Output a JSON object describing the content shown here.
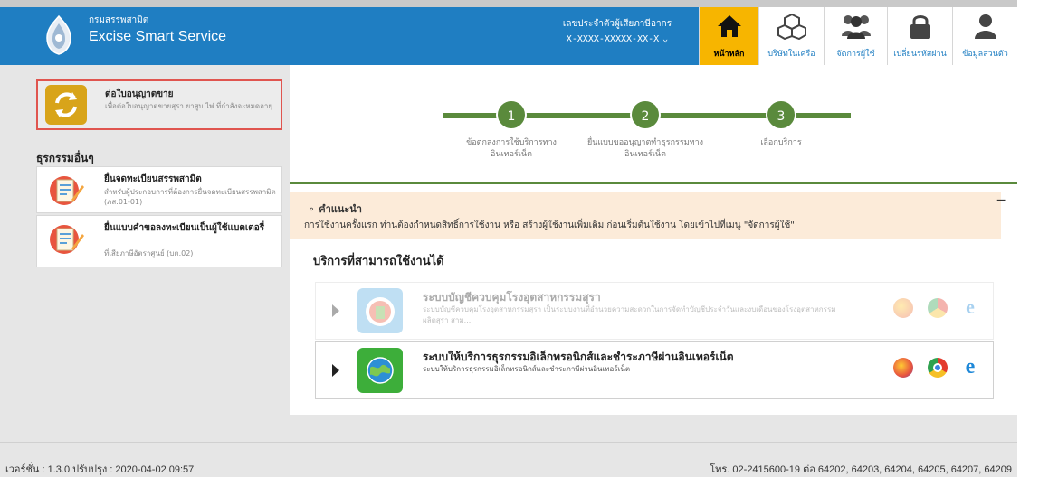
{
  "header": {
    "department": "กรมสรรพสามิต",
    "app_title": "Excise Smart Service",
    "taxid_label": "เลขประจำตัวผู้เสียภาษีอากร",
    "taxid_value": "X-XXXX-XXXXX-XX-X",
    "taxid_chevron": "⌄",
    "brand_color": "#1f7ec2",
    "active_color": "#f7b500"
  },
  "nav": [
    {
      "label": "หน้าหลัก",
      "icon": "home-icon",
      "active": true
    },
    {
      "label": "บริษัทในเครือ",
      "icon": "boxes-icon",
      "active": false
    },
    {
      "label": "จัดการผู้ใช้",
      "icon": "users-icon",
      "active": false
    },
    {
      "label": "เปลี่ยนรหัสผ่าน",
      "icon": "lock-icon",
      "active": false
    },
    {
      "label": "ข้อมูลส่วนตัว",
      "icon": "user-icon",
      "active": false
    }
  ],
  "sidebar": {
    "renew": {
      "title": "ต่อใบอนุญาตขาย",
      "desc": "เพื่อต่อใบอนุญาตขายสุรา ยาสูบ ไพ่ ที่กำลังจะหมดอายุ"
    },
    "section_title": "ธุรกรรมอื่นๆ",
    "items": [
      {
        "title": "ยื่นจดทะเบียนสรรพสามิต",
        "desc": "สำหรับผู้ประกอบการที่ต้องการยื่นจดทะเบียนสรรพสามิต (ภส.01-01)"
      },
      {
        "title": "ยื่นแบบคำขอลงทะเบียนเป็นผู้ใช้แบตเตอรี่",
        "desc": "ที่เสียภาษีอัตราศูนย์ (บต.02)"
      }
    ]
  },
  "steps": [
    {
      "number": "1",
      "label": "ข้อตกลงการใช้บริการทางอินเทอร์เน็ต"
    },
    {
      "number": "2",
      "label": "ยื่นแบบขออนุญาตทำธุรกรรมทางอินเทอร์เน็ต"
    },
    {
      "number": "3",
      "label": "เลือกบริการ"
    }
  ],
  "tip": {
    "title": "คำแนะนำ",
    "text": "การใช้งานครั้งแรก ท่านต้องกำหนดสิทธิ์การใช้งาน หรือ สร้างผู้ใช้งานเพิ่มเติม ก่อนเริ่มต้นใช้งาน โดยเข้าไปที่เมนู \"จัดการผู้ใช้\"",
    "collapse": "−"
  },
  "services": {
    "title": "บริการที่สามารถใช้งานได้",
    "items": [
      {
        "title": "ระบบบัญชีควบคุมโรงอุตสาหกรรมสุรา",
        "desc": "ระบบบัญชีควบคุมโรงอุตสาหกรรมสุรา เป็นระบบงานที่อำนวยความสะดวกในการจัดทำบัญชีประจำวันและงบเดือนของโรงอุตสาหกรรมผลิตสุรา สาม...",
        "enabled": false
      },
      {
        "title": "ระบบให้บริการธุรกรรมอิเล็กทรอนิกส์และชำระภาษีผ่านอินเทอร์เน็ต",
        "desc": "ระบบให้บริการธุรกรรมอิเล็กทรอนิกส์และชำระภาษีผ่านอินเทอร์เน็ต",
        "enabled": true
      }
    ],
    "browsers": [
      "firefox-icon",
      "chrome-icon",
      "ie-icon"
    ]
  },
  "footer": {
    "version": "เวอร์ชั่น : 1.3.0 ปรับปรุง : 2020-04-02 09:57",
    "contact": "โทร. 02-2415600-19 ต่อ 64202, 64203, 64204, 64205, 64207, 64209"
  }
}
